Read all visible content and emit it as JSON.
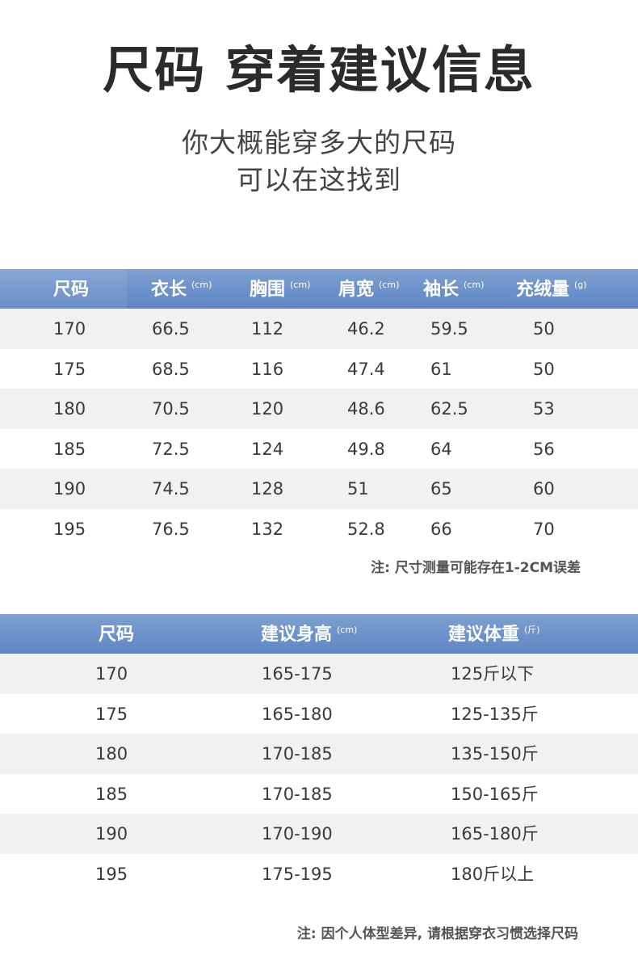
{
  "header": {
    "title": "尺码 穿着建议信息",
    "subtitle_line1": "你大概能穿多大的尺码",
    "subtitle_line2": "可以在这找到"
  },
  "size_table": {
    "columns": [
      {
        "label": "尺码",
        "unit": ""
      },
      {
        "label": "衣长",
        "unit": "(cm)"
      },
      {
        "label": "胸围",
        "unit": "(cm)"
      },
      {
        "label": "肩宽",
        "unit": "(cm)"
      },
      {
        "label": "袖长",
        "unit": "(cm)"
      },
      {
        "label": "充绒量",
        "unit": "(g)"
      }
    ],
    "rows": [
      [
        "170",
        "66.5",
        "112",
        "46.2",
        "59.5",
        "50"
      ],
      [
        "175",
        "68.5",
        "116",
        "47.4",
        "61",
        "50"
      ],
      [
        "180",
        "70.5",
        "120",
        "48.6",
        "62.5",
        "53"
      ],
      [
        "185",
        "72.5",
        "124",
        "49.8",
        "64",
        "56"
      ],
      [
        "190",
        "74.5",
        "128",
        "51",
        "65",
        "60"
      ],
      [
        "195",
        "76.5",
        "132",
        "52.8",
        "66",
        "70"
      ]
    ],
    "note": "注: 尺寸测量可能存在1-2CM误差"
  },
  "fit_table": {
    "columns": [
      {
        "label": "尺码",
        "unit": ""
      },
      {
        "label": "建议身高",
        "unit": "(cm)"
      },
      {
        "label": "建议体重",
        "unit": "(斤)"
      }
    ],
    "rows": [
      [
        "170",
        "165-175",
        "125斤以下"
      ],
      [
        "175",
        "165-180",
        "125-135斤"
      ],
      [
        "180",
        "170-185",
        "135-150斤"
      ],
      [
        "185",
        "170-185",
        "150-165斤"
      ],
      [
        "190",
        "170-190",
        "165-180斤"
      ],
      [
        "195",
        "175-195",
        "180斤以上"
      ]
    ],
    "note": "注: 因个人体型差异, 请根据穿衣习惯选择尺码"
  }
}
